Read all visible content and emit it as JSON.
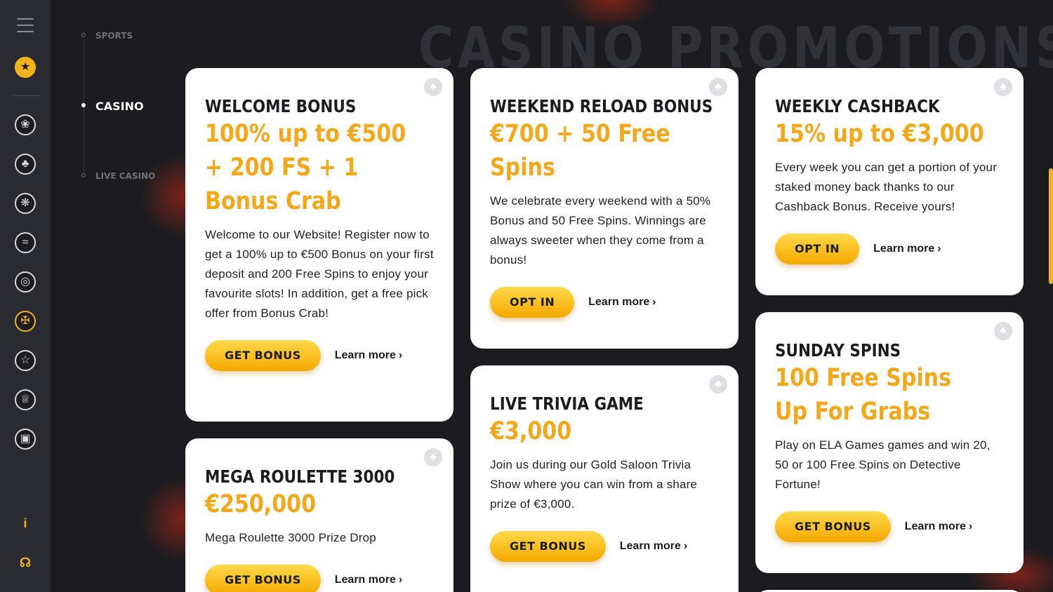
{
  "page": {
    "title": "CASINO PROMOTIONS"
  },
  "subnav": [
    {
      "label": "SPORTS",
      "active": false
    },
    {
      "label": "CASINO",
      "active": true
    },
    {
      "label": "LIVE CASINO",
      "active": false
    }
  ],
  "sidebar": {
    "icons": [
      "menu-icon",
      "avatar-icon",
      "film-reel-icon",
      "club-icon",
      "roulette-icon",
      "wifi-icon",
      "globe-icon",
      "wheel-icon",
      "star-icon",
      "trophy-icon",
      "lock-icon",
      "info-icon",
      "headset-icon"
    ],
    "info_glyph": "i",
    "accent": "#f2b21c"
  },
  "cards": [
    {
      "title": "WELCOME BONUS",
      "amount": "100% up to €500 + 200 FS + 1 Bonus Crab",
      "description": "Welcome to our Website! Register now to get a 100% up to €500 Bonus on your first deposit and 200 Free Spins to enjoy your favourite slots! In addition, get a free pick offer from Bonus Crab!",
      "button": "GET BONUS",
      "learn": "Learn more"
    },
    {
      "title": "WEEKEND RELOAD BONUS",
      "amount": "€700 + 50 Free Spins",
      "description": "We celebrate every weekend with a 50% Bonus and 50 Free Spins. Winnings are always sweeter when they come from a bonus!",
      "button": "OPT IN",
      "learn": "Learn more"
    },
    {
      "title": "WEEKLY CASHBACK",
      "amount": "15% up to €3,000",
      "description": "Every week you can get a portion of your staked money back thanks to our Cashback Bonus. Receive yours!",
      "button": "OPT IN",
      "learn": "Learn more"
    },
    {
      "title": "MEGA ROULETTE 3000",
      "amount": "€250,000",
      "description": "Mega Roulette 3000 Prize Drop",
      "button": "GET BONUS",
      "learn": "Learn more"
    },
    {
      "title": "LIVE TRIVIA GAME",
      "amount": "€3,000",
      "description": "Join us during our Gold Saloon Trivia Show where you can win from a share prize of €3,000.",
      "button": "GET BONUS",
      "learn": "Learn more"
    },
    {
      "title": "SUNDAY SPINS",
      "amount": "100 Free Spins Up For Grabs",
      "description": "Play on ELA Games games and win 20, 50 or 100 Free Spins on Detective Fortune!",
      "button": "GET BONUS",
      "learn": "Learn more"
    }
  ]
}
